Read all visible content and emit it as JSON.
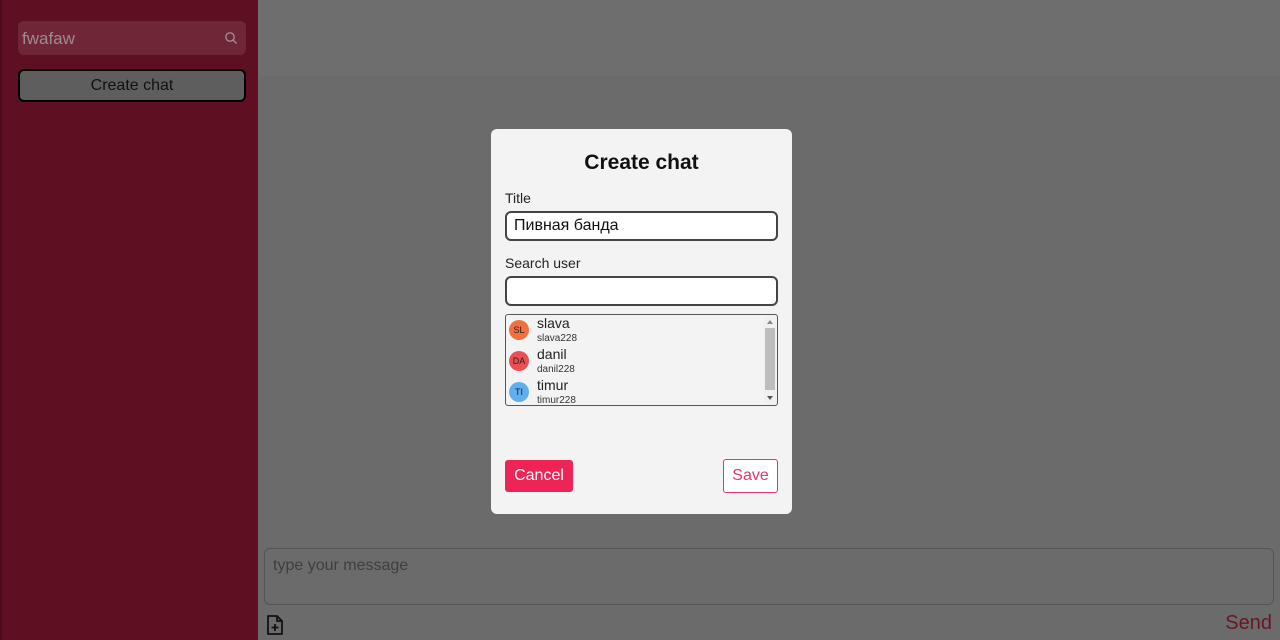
{
  "sidebar": {
    "search_value": "fwafaw",
    "create_chat_label": "Create chat"
  },
  "composer": {
    "placeholder": "type your message",
    "send_label": "Send"
  },
  "modal": {
    "title": "Create chat",
    "title_label": "Title",
    "title_value": "Пивная банда",
    "search_label": "Search user",
    "search_value": "",
    "users": [
      {
        "initials": "SL",
        "name": "slava",
        "login": "slava228",
        "color": "#f2703f"
      },
      {
        "initials": "DA",
        "name": "danil",
        "login": "danil228",
        "color": "#ea4f55"
      },
      {
        "initials": "TI",
        "name": "timur",
        "login": "timur228",
        "color": "#5eaef0"
      }
    ],
    "cancel_label": "Cancel",
    "save_label": "Save"
  },
  "colors": {
    "accent": "#ee2456",
    "sidebar": "#5f0f22"
  },
  "icons": {
    "search": "search-icon",
    "attach": "file-plus-icon"
  }
}
